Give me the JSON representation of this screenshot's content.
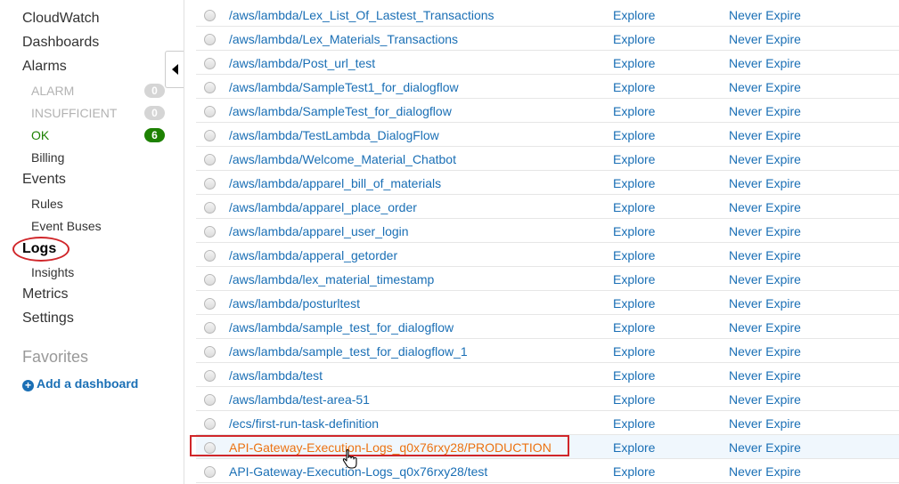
{
  "sidebar": {
    "cloudwatch": "CloudWatch",
    "dashboards": "Dashboards",
    "alarms": "Alarms",
    "alarm_states": [
      {
        "label": "ALARM",
        "count": "0"
      },
      {
        "label": "INSUFFICIENT",
        "count": "0"
      },
      {
        "label": "OK",
        "count": "6"
      }
    ],
    "billing": "Billing",
    "events": "Events",
    "rules": "Rules",
    "event_buses": "Event Buses",
    "logs": "Logs",
    "insights": "Insights",
    "metrics": "Metrics",
    "settings": "Settings",
    "favorites": "Favorites",
    "add_dashboard": "Add a dashboard"
  },
  "colors": {
    "link": "#1a6fb5",
    "link_hover": "#ec7211",
    "ok_green": "#1d8102",
    "annotation_red": "#d0262a"
  },
  "log_groups": [
    {
      "name": "/aws/lambda/Lex_List_Of_Lastest_Transactions",
      "action": "Explore",
      "retention": "Never Expire"
    },
    {
      "name": "/aws/lambda/Lex_Materials_Transactions",
      "action": "Explore",
      "retention": "Never Expire"
    },
    {
      "name": "/aws/lambda/Post_url_test",
      "action": "Explore",
      "retention": "Never Expire"
    },
    {
      "name": "/aws/lambda/SampleTest1_for_dialogflow",
      "action": "Explore",
      "retention": "Never Expire"
    },
    {
      "name": "/aws/lambda/SampleTest_for_dialogflow",
      "action": "Explore",
      "retention": "Never Expire"
    },
    {
      "name": "/aws/lambda/TestLambda_DialogFlow",
      "action": "Explore",
      "retention": "Never Expire"
    },
    {
      "name": "/aws/lambda/Welcome_Material_Chatbot",
      "action": "Explore",
      "retention": "Never Expire"
    },
    {
      "name": "/aws/lambda/apparel_bill_of_materials",
      "action": "Explore",
      "retention": "Never Expire"
    },
    {
      "name": "/aws/lambda/apparel_place_order",
      "action": "Explore",
      "retention": "Never Expire"
    },
    {
      "name": "/aws/lambda/apparel_user_login",
      "action": "Explore",
      "retention": "Never Expire"
    },
    {
      "name": "/aws/lambda/apperal_getorder",
      "action": "Explore",
      "retention": "Never Expire"
    },
    {
      "name": "/aws/lambda/lex_material_timestamp",
      "action": "Explore",
      "retention": "Never Expire"
    },
    {
      "name": "/aws/lambda/posturltest",
      "action": "Explore",
      "retention": "Never Expire"
    },
    {
      "name": "/aws/lambda/sample_test_for_dialogflow",
      "action": "Explore",
      "retention": "Never Expire"
    },
    {
      "name": "/aws/lambda/sample_test_for_dialogflow_1",
      "action": "Explore",
      "retention": "Never Expire"
    },
    {
      "name": "/aws/lambda/test",
      "action": "Explore",
      "retention": "Never Expire"
    },
    {
      "name": "/aws/lambda/test-area-51",
      "action": "Explore",
      "retention": "Never Expire"
    },
    {
      "name": "/ecs/first-run-task-definition",
      "action": "Explore",
      "retention": "Never Expire"
    },
    {
      "name": "API-Gateway-Execution-Logs_q0x76rxy28/PRODUCTION",
      "action": "Explore",
      "retention": "Never Expire",
      "hovered": true
    },
    {
      "name": "API-Gateway-Execution-Logs_q0x76rxy28/test",
      "action": "Explore",
      "retention": "Never Expire"
    }
  ]
}
